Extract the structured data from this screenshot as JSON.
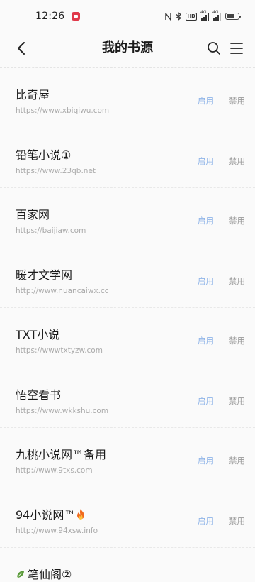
{
  "status_bar": {
    "time": "12:26",
    "hd_label": "HD",
    "signal_label_1": "4G",
    "signal_label_2": "4G"
  },
  "header": {
    "title": "我的书源"
  },
  "actions": {
    "enable_label": "启用",
    "disable_label": "禁用"
  },
  "sources": [
    {
      "name": "比奇屋",
      "url": "https://www.xbiqiwu.com"
    },
    {
      "name": "铅笔小说①",
      "url": "https://www.23qb.net"
    },
    {
      "name": "百家网",
      "url": "https://baijiaw.com"
    },
    {
      "name": "暖才文学网",
      "url": "http://www.nuancaiwx.cc"
    },
    {
      "name": "TXT小说",
      "url": "https://wwwtxtyzw.com"
    },
    {
      "name": "悟空看书",
      "url": "https://www.wkkshu.com"
    },
    {
      "name": "九桃小说网™备用",
      "url": "http://www.9txs.com"
    },
    {
      "name": "94小说网™",
      "url": "http://www.94xsw.info"
    }
  ],
  "partial_source": {
    "name": "笔仙阁②"
  },
  "colors": {
    "enable": "#8fb4e8",
    "disable": "#9a9a9a",
    "background": "#fafafa",
    "flame": "#f06a1e",
    "leaf": "#5a9a3a"
  },
  "icons": {
    "back": "chevron-left-icon",
    "search": "search-icon",
    "menu": "menu-icon",
    "flame": "fire-icon",
    "leaf": "leaf-icon"
  }
}
